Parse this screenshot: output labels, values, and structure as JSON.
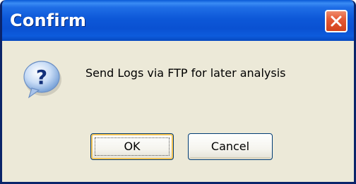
{
  "dialog": {
    "title": "Confirm",
    "message": "Send Logs via FTP for later analysis",
    "icon": "question-icon"
  },
  "buttons": {
    "ok_label": "OK",
    "cancel_label": "Cancel"
  },
  "colors": {
    "titlebar": "#0a51d2",
    "body": "#ece9d8",
    "close_button": "#e45a36",
    "focus_ring": "#f6c556"
  }
}
